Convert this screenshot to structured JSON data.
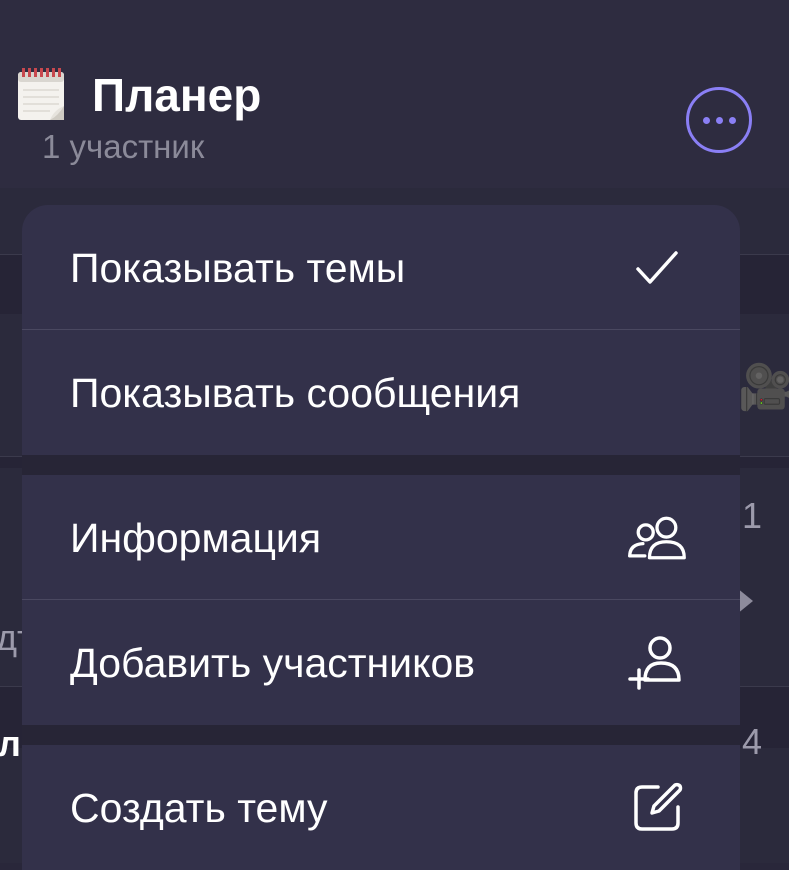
{
  "header": {
    "title": "Планер",
    "subtitle": "1 участник",
    "title_icon": "calendar-icon",
    "more_icon": "ellipsis-circle-icon"
  },
  "background_list": {
    "partial_text": [
      "дт",
      "л"
    ],
    "counts": [
      "1",
      "4"
    ],
    "icons": [
      "movie-camera-icon",
      "play-arrow-icon"
    ]
  },
  "menu": {
    "groups": [
      {
        "items": [
          {
            "label": "Показывать темы",
            "icon": "checkmark-icon",
            "selected": true
          },
          {
            "label": "Показывать сообщения",
            "icon": "",
            "selected": false
          }
        ]
      },
      {
        "items": [
          {
            "label": "Информация",
            "icon": "people-icon"
          },
          {
            "label": "Добавить участников",
            "icon": "add-person-icon"
          }
        ]
      },
      {
        "items": [
          {
            "label": "Создать тему",
            "icon": "compose-icon"
          }
        ]
      }
    ]
  },
  "colors": {
    "accent": "#8a7ff5",
    "menu_background": "#33314a",
    "page_background": "#29273a",
    "subtitle": "#8b8a99"
  }
}
